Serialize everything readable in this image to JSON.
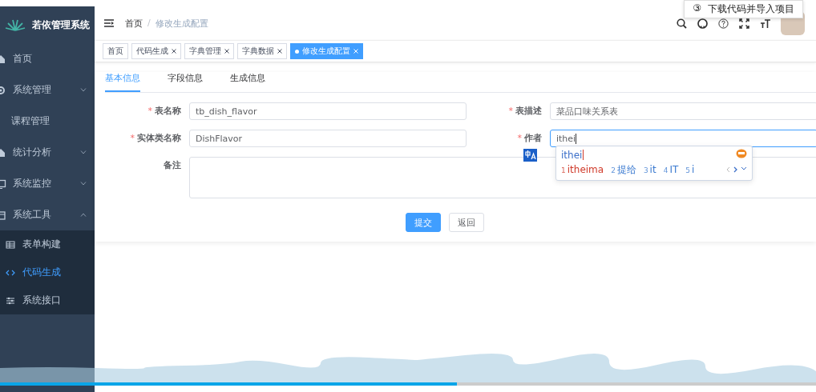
{
  "sidebar": {
    "title": "若依管理系统",
    "items": [
      {
        "label": "首页",
        "kind": "item"
      },
      {
        "label": "系统管理",
        "kind": "group",
        "expanded": false
      },
      {
        "label": "课程管理",
        "kind": "item"
      },
      {
        "label": "统计分析",
        "kind": "group",
        "expanded": false
      },
      {
        "label": "系统监控",
        "kind": "group",
        "expanded": false
      },
      {
        "label": "系统工具",
        "kind": "group",
        "expanded": true,
        "children": [
          {
            "label": "表单构建",
            "selected": false
          },
          {
            "label": "代码生成",
            "selected": true
          },
          {
            "label": "系统接口",
            "selected": false
          }
        ]
      }
    ]
  },
  "header": {
    "breadcrumb": [
      "首页",
      "修改生成配置"
    ],
    "separator": "/"
  },
  "tooltip": {
    "step": "③",
    "text": "下载代码并导入项目"
  },
  "tags": [
    {
      "label": "首页",
      "selected": false,
      "closable": false
    },
    {
      "label": "代码生成",
      "selected": false,
      "closable": true
    },
    {
      "label": "字典管理",
      "selected": false,
      "closable": true
    },
    {
      "label": "字典数据",
      "selected": false,
      "closable": true
    },
    {
      "label": "修改生成配置",
      "selected": true,
      "closable": true
    }
  ],
  "form": {
    "tabs": [
      {
        "label": "基本信息",
        "selected": true
      },
      {
        "label": "字段信息",
        "selected": false
      },
      {
        "label": "生成信息",
        "selected": false
      }
    ],
    "fields": [
      {
        "label": "表名称",
        "required_mark": "*",
        "value": "tb_dish_flavor",
        "kind": "input",
        "focused": false
      },
      {
        "label": "表描述",
        "required_mark": "*",
        "value": "菜品口味关系表",
        "kind": "input",
        "focused": false
      },
      {
        "label": "实体类名称",
        "required_mark": "*",
        "value": "DishFlavor",
        "kind": "input",
        "focused": false
      },
      {
        "label": "作者",
        "required_mark": "*",
        "value": "ithei",
        "kind": "input",
        "focused": true
      },
      {
        "label": "备注",
        "kind": "textarea",
        "focused": false
      }
    ],
    "buttons": [
      {
        "label": "提交",
        "kind": "primary"
      },
      {
        "label": "返回",
        "kind": "default"
      }
    ]
  },
  "ime": {
    "composition": "ithei",
    "candidates": [
      {
        "index": "1",
        "text": "itheima",
        "selected": true
      },
      {
        "index": "2",
        "text": "提给",
        "selected": false
      },
      {
        "index": "3",
        "text": "it",
        "selected": false
      },
      {
        "index": "4",
        "text": "IT",
        "selected": false
      },
      {
        "index": "5",
        "text": "i",
        "selected": false
      }
    ]
  },
  "player": {
    "progress": {
      "level": 0.56
    }
  }
}
